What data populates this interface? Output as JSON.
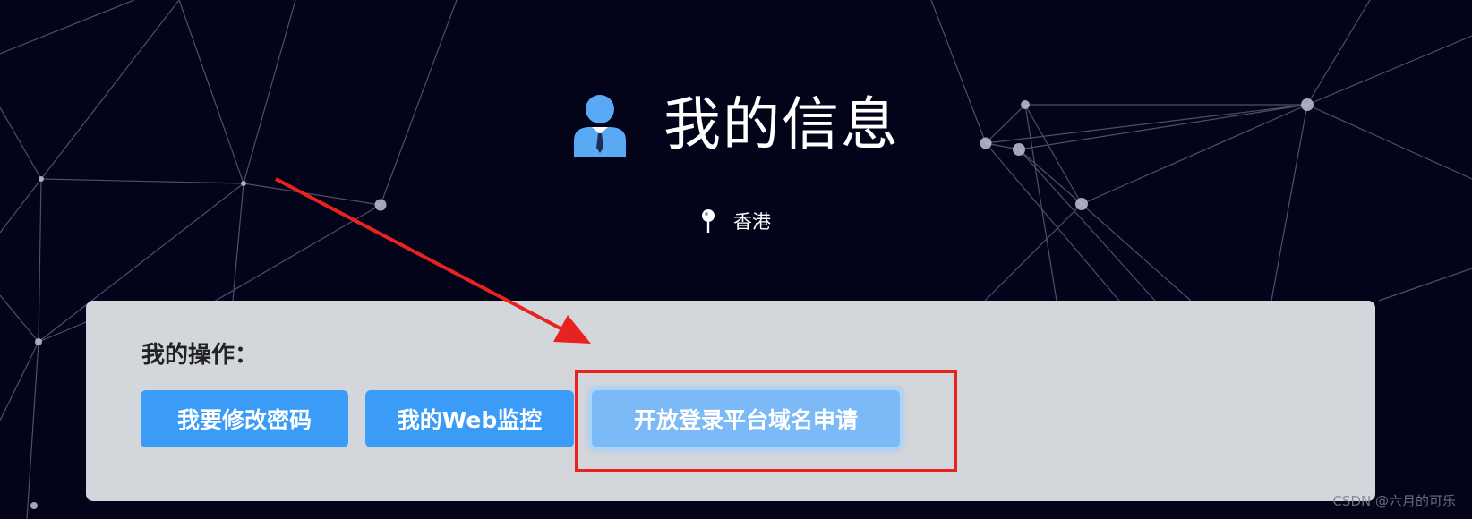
{
  "header": {
    "title": "我的信息",
    "title_icon": "user-tie-icon",
    "location_icon": "map-pin-icon",
    "location": "香港"
  },
  "panel": {
    "heading": "我的操作：",
    "buttons": [
      {
        "label": "我要修改密码",
        "state": "normal"
      },
      {
        "label": "我的Web监控",
        "state": "normal"
      },
      {
        "label": "开放登录平台域名申请",
        "state": "focused"
      }
    ]
  },
  "annotation": {
    "arrow_color": "#e8231f",
    "box_color": "#e8231f"
  },
  "watermark": "CSDN @六月的可乐",
  "colors": {
    "background": "#03031a",
    "panel": "#d3d6db",
    "button": "#3b9cf8",
    "button_focused": "#7bbaf6",
    "accent_icon": "#5aa9f5"
  }
}
